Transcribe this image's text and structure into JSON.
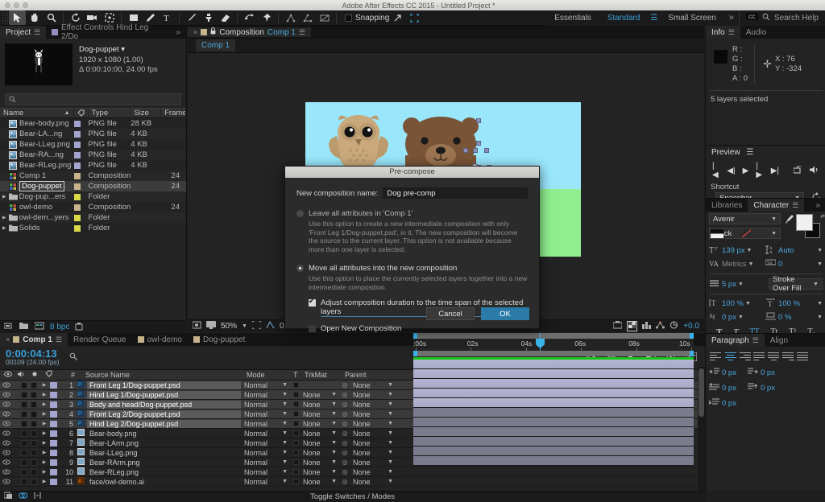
{
  "window": {
    "title": "Adobe After Effects CC 2015 - Untitled Project *"
  },
  "toolbar": {
    "tools": [
      {
        "name": "selection-tool",
        "glyph": "➤"
      },
      {
        "name": "hand-tool",
        "glyph": "✋"
      },
      {
        "name": "zoom-tool",
        "glyph": "🔍"
      },
      {
        "name": "rotation-tool",
        "glyph": "↻"
      },
      {
        "name": "camera-tool",
        "glyph": "🎥"
      },
      {
        "name": "anchor-point-tool",
        "glyph": "⛶"
      },
      {
        "name": "shape-tool",
        "glyph": "▭"
      },
      {
        "name": "pen-tool",
        "glyph": "✒"
      },
      {
        "name": "type-tool",
        "glyph": "T"
      },
      {
        "name": "brush-tool",
        "glyph": "／"
      },
      {
        "name": "clone-stamp-tool",
        "glyph": "⚲"
      },
      {
        "name": "eraser-tool",
        "glyph": "◣"
      },
      {
        "name": "roto-brush-tool",
        "glyph": "⌁"
      },
      {
        "name": "puppet-pin-tool",
        "glyph": "📌"
      }
    ],
    "snapping_label": "Snapping",
    "workspaces": [
      {
        "label": "Essentials",
        "active": false
      },
      {
        "label": "Standard",
        "active": true
      },
      {
        "label": "Small Screen",
        "active": false
      }
    ],
    "more_label": "»",
    "search_placeholder": "Search Help"
  },
  "project": {
    "tabs": [
      {
        "label": "Project",
        "active": true
      },
      {
        "label": "Effect Controls Hind Leg 2/Do",
        "active": false
      }
    ],
    "selected_item": {
      "name": "Dog-puppet ▾",
      "resolution": "1920 x 1080 (1.00)",
      "duration": "Δ 0:00:10:00, 24.00 fps"
    },
    "columns": [
      "Name",
      "Type",
      "Size",
      "Frame ..."
    ],
    "items": [
      {
        "name": "Bear-body.png",
        "kind": "png",
        "tag": "#a3a3cf",
        "type": "PNG file",
        "size": "28 KB",
        "frame": "",
        "selected": false
      },
      {
        "name": "Bear-LA...ng",
        "kind": "png",
        "tag": "#a3a3cf",
        "type": "PNG file",
        "size": "4 KB",
        "frame": "",
        "selected": false
      },
      {
        "name": "Bear-LLeg.png",
        "kind": "png",
        "tag": "#a3a3cf",
        "type": "PNG file",
        "size": "4 KB",
        "frame": "",
        "selected": false
      },
      {
        "name": "Bear-RA...ng",
        "kind": "png",
        "tag": "#a3a3cf",
        "type": "PNG file",
        "size": "4 KB",
        "frame": "",
        "selected": false
      },
      {
        "name": "Bear-RLeg.png",
        "kind": "png",
        "tag": "#a3a3cf",
        "type": "PNG file",
        "size": "4 KB",
        "frame": "",
        "selected": false
      },
      {
        "name": "Comp 1",
        "kind": "comp",
        "tag": "#c8b48c",
        "type": "Composition",
        "size": "",
        "frame": "24",
        "selected": false
      },
      {
        "name": "Dog-puppet",
        "kind": "comp",
        "tag": "#c8b48c",
        "type": "Composition",
        "size": "",
        "frame": "24",
        "selected": true
      },
      {
        "name": "Dog-pup...ers",
        "kind": "folder",
        "tag": "#d8d848",
        "type": "Folder",
        "size": "",
        "frame": "",
        "selected": false
      },
      {
        "name": "owl-demo",
        "kind": "comp",
        "tag": "#c8b48c",
        "type": "Composition",
        "size": "",
        "frame": "24",
        "selected": false
      },
      {
        "name": "owl-dem...yers",
        "kind": "folder",
        "tag": "#d8d848",
        "type": "Folder",
        "size": "",
        "frame": "",
        "selected": false
      },
      {
        "name": "Solids",
        "kind": "folder",
        "tag": "#d8d848",
        "type": "Folder",
        "size": "",
        "frame": "",
        "selected": false
      }
    ],
    "bit_depth": "8 bpc"
  },
  "composition": {
    "tab_label": "Composition",
    "tab_name": "Comp 1",
    "chip_label": "Comp 1",
    "zoom": "50%",
    "offset": "+0.0",
    "resolution_value": "0",
    "canvas": {
      "sky_color": "#9ae7fb",
      "ground_color": "#90ee90"
    }
  },
  "info": {
    "tabs": [
      {
        "label": "Info",
        "active": true
      },
      {
        "label": "Audio",
        "active": false
      }
    ],
    "r_label": "R :",
    "g_label": "G :",
    "b_label": "B :",
    "a_label": "A :",
    "a_value": "0",
    "x_label": "X : 76",
    "y_label": "Y : -324",
    "status": "5 layers selected"
  },
  "preview": {
    "tab_label": "Preview",
    "shortcut_label": "Shortcut",
    "shortcut_value": "Spacebar"
  },
  "character": {
    "tabs": [
      {
        "label": "Libraries",
        "active": false
      },
      {
        "label": "Character",
        "active": true
      }
    ],
    "font_family": "Avenir",
    "font_style": "Black",
    "font_size": "139 px",
    "leading": "Auto",
    "kerning_label": "Metrics",
    "tracking": "0",
    "stroke_width": "5 px",
    "stroke_order": "Stroke Over Fill",
    "vertical_scale": "100 %",
    "horizontal_scale": "100 %",
    "baseline_shift": "0 px",
    "tsume": "0 %",
    "style_buttons": [
      {
        "glyph": "T",
        "active": false
      },
      {
        "glyph": "T",
        "active": false
      },
      {
        "glyph": "TT",
        "active": true
      },
      {
        "glyph": "Tt",
        "active": false
      },
      {
        "glyph": "T¹",
        "active": false
      },
      {
        "glyph": "T₁",
        "active": false
      }
    ]
  },
  "paragraph": {
    "tabs": [
      {
        "label": "Paragraph",
        "active": true
      },
      {
        "label": "Align",
        "active": false
      }
    ],
    "indents": [
      {
        "name": "indent-left",
        "value": "0 px"
      },
      {
        "name": "indent-right",
        "value": "0 px"
      },
      {
        "name": "indent-first-line",
        "value": "0 px"
      },
      {
        "name": "space-before",
        "value": "0 px"
      },
      {
        "name": "space-after",
        "value": "0 px"
      }
    ]
  },
  "timeline": {
    "tabs": [
      {
        "label": "Comp 1",
        "active": true,
        "swatch": true
      },
      {
        "label": "Render Queue",
        "active": false,
        "swatch": false
      },
      {
        "label": "owl-demo",
        "active": false,
        "swatch": true
      },
      {
        "label": "Dog-puppet",
        "active": false,
        "swatch": true
      }
    ],
    "timecode": "0:00:04:13",
    "frames": "00109 (24.00 fps)",
    "columns": [
      "#",
      "Source Name",
      "Mode",
      "T",
      "TrkMat",
      "Parent"
    ],
    "ruler_labels": [
      ":00s",
      "02s",
      "04s",
      "06s",
      "08s",
      "10s"
    ],
    "status_label": "Toggle Switches / Modes",
    "layers": [
      {
        "num": "1",
        "name": "Front Leg 1/Dog-puppet.psd",
        "mode": "Normal",
        "trkmat": "",
        "parent": "None",
        "selected": true
      },
      {
        "num": "2",
        "name": "Hind Leg 1/Dog-puppet.psd",
        "mode": "Normal",
        "trkmat": "None",
        "parent": "None",
        "selected": true
      },
      {
        "num": "3",
        "name": "Body and head/Dog-puppet.psd",
        "mode": "Normal",
        "trkmat": "None",
        "parent": "None",
        "selected": true
      },
      {
        "num": "4",
        "name": "Front Leg 2/Dog-puppet.psd",
        "mode": "Normal",
        "trkmat": "None",
        "parent": "None",
        "selected": true
      },
      {
        "num": "5",
        "name": "Hind Leg 2/Dog-puppet.psd",
        "mode": "Normal",
        "trkmat": "None",
        "parent": "None",
        "selected": true
      },
      {
        "num": "6",
        "name": "Bear-body.png",
        "mode": "Normal",
        "trkmat": "None",
        "parent": "None",
        "selected": false
      },
      {
        "num": "7",
        "name": "Bear-LArm.png",
        "mode": "Normal",
        "trkmat": "None",
        "parent": "None",
        "selected": false
      },
      {
        "num": "8",
        "name": "Bear-LLeg.png",
        "mode": "Normal",
        "trkmat": "None",
        "parent": "None",
        "selected": false
      },
      {
        "num": "9",
        "name": "Bear-RArm.png",
        "mode": "Normal",
        "trkmat": "None",
        "parent": "None",
        "selected": false
      },
      {
        "num": "10",
        "name": "Bear-RLeg.png",
        "mode": "Normal",
        "trkmat": "None",
        "parent": "None",
        "selected": false
      },
      {
        "num": "11",
        "name": "face/owl-demo.ai",
        "mode": "Normal",
        "trkmat": "None",
        "parent": "None",
        "selected": false
      }
    ]
  },
  "dialog": {
    "title": "Pre-compose",
    "name_label": "New composition name:",
    "name_value": "Dog pre-comp",
    "option_leave": {
      "title": "Leave all attributes in 'Comp 1'",
      "description": "Use this option to create a new intermediate composition with only 'Front Leg 1/Dog-puppet.psd', in it. The new composition will become the source to the current layer. This option is not available because more than one layer is selected.",
      "selected": false
    },
    "option_move": {
      "title": "Move all attributes into the new composition",
      "description": "Use this option to place the currently selected layers together into a new intermediate composition.",
      "selected": true
    },
    "checkbox_adjust": {
      "label": "Adjust composition duration to the time span of the selected layers",
      "checked": true
    },
    "checkbox_open": {
      "label": "Open New Composition",
      "checked": false
    },
    "cancel_label": "Cancel",
    "ok_label": "OK"
  }
}
